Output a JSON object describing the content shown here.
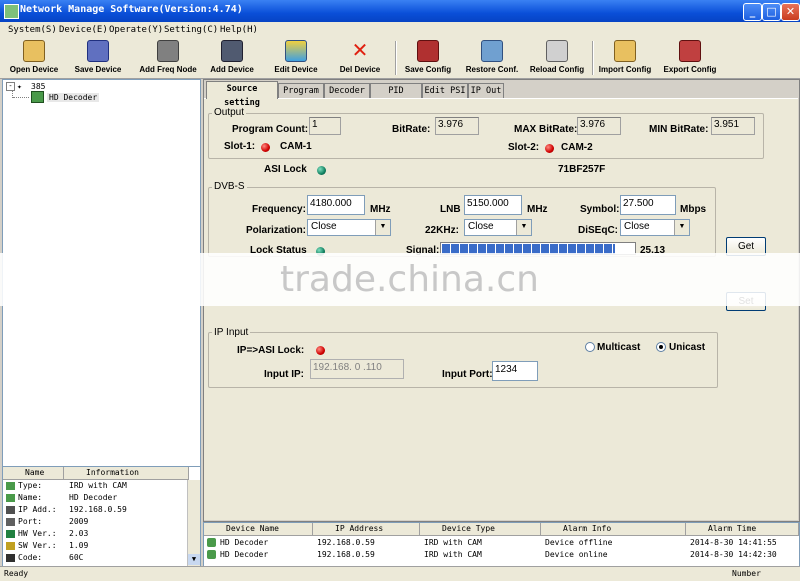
{
  "window": {
    "title": "Network Manage Software(Version:4.74)"
  },
  "menu": [
    "System(S)",
    "Device(E)",
    "Operate(Y)",
    "Setting(C)",
    "Help(H)"
  ],
  "toolbar": [
    {
      "label": "Open Device",
      "icon": "open-device-icon"
    },
    {
      "label": "Save Device",
      "icon": "save-device-icon"
    },
    {
      "label": "Add Freq Node",
      "icon": "add-freq-node-icon"
    },
    {
      "label": "Add Device",
      "icon": "add-device-icon"
    },
    {
      "label": "Edit Device",
      "icon": "edit-device-icon"
    },
    {
      "label": "Del Device",
      "icon": "delete-icon"
    },
    {
      "label": "Save Config",
      "icon": "save-config-icon"
    },
    {
      "label": "Restore Conf.",
      "icon": "restore-config-icon"
    },
    {
      "label": "Reload Config",
      "icon": "reload-config-icon"
    },
    {
      "label": "Import Config",
      "icon": "import-config-icon"
    },
    {
      "label": "Export Config",
      "icon": "export-config-icon"
    }
  ],
  "tree": {
    "root": "385",
    "child": "HD Decoder"
  },
  "info": {
    "headers": [
      "Name",
      "Information"
    ],
    "rows": [
      {
        "name": "Type:",
        "value": "IRD with CAM"
      },
      {
        "name": "Name:",
        "value": "HD Decoder"
      },
      {
        "name": "IP Add.:",
        "value": "192.168.0.59"
      },
      {
        "name": "Port:",
        "value": "2009"
      },
      {
        "name": "HW Ver.:",
        "value": "2.03"
      },
      {
        "name": "SW Ver.:",
        "value": "1.09"
      },
      {
        "name": "Code:",
        "value": "60C"
      }
    ]
  },
  "tabs": [
    "Source setting",
    "Program",
    "Decoder",
    "PID Filter",
    "Edit PSI",
    "IP Out"
  ],
  "output": {
    "group": "Output",
    "program_count_label": "Program Count:",
    "program_count": "1",
    "bitrate_label": "BitRate:",
    "bitrate": "3.976",
    "max_bitrate_label": "MAX BitRate:",
    "max_bitrate": "3.976",
    "min_bitrate_label": "MIN BitRate:",
    "min_bitrate": "3.951",
    "slot1_label": "Slot-1:",
    "slot1_value": "CAM-1",
    "slot2_label": "Slot-2:",
    "slot2_value": "CAM-2",
    "asi_lock_label": "ASI Lock",
    "code": "71BF257F"
  },
  "dvbs": {
    "group": "DVB-S",
    "frequency_label": "Frequency:",
    "frequency": "4180.000",
    "frequency_unit": "MHz",
    "lnb_label": "LNB",
    "lnb": "5150.000",
    "lnb_unit": "MHz",
    "symbol_label": "Symbol:",
    "symbol": "27.500",
    "symbol_unit": "Mbps",
    "polarization_label": "Polarization:",
    "polarization": "Close",
    "khz_label": "22KHz:",
    "khz": "Close",
    "diseqc_label": "DiSEqC:",
    "diseqc": "Close",
    "lock_status_label": "Lock Status",
    "signal_label": "Signal:",
    "signal_value": "25.13",
    "signal_level": 0.9
  },
  "buttons": {
    "get": "Get",
    "set": "Set"
  },
  "ip_input": {
    "group": "IP Input",
    "asi_lock_label": "IP=>ASI Lock:",
    "multicast_label": "Multicast",
    "unicast_label": "Unicast",
    "input_ip_label": "Input IP:",
    "input_ip": "192.168. 0 .110",
    "input_port_label": "Input Port:",
    "input_port": "1234"
  },
  "alarm_table": {
    "headers": [
      "Device Name",
      "IP Address",
      "Device Type",
      "Alarm Info",
      "Alarm Time"
    ],
    "rows": [
      [
        "HD Decoder",
        "192.168.0.59",
        "IRD with CAM",
        "Device offline",
        "2014-8-30 14:41:55"
      ],
      [
        "HD Decoder",
        "192.168.0.59",
        "IRD with CAM",
        "Device online",
        "2014-8-30 14:42:30"
      ]
    ]
  },
  "status": {
    "left": "Ready",
    "right": "Number"
  },
  "watermark": "trade.china.cn",
  "colors": {
    "title_bar": "#0a4fd8",
    "led_red": "#d00000",
    "led_green": "#108060",
    "signal_bar": "#3a6cc8"
  }
}
